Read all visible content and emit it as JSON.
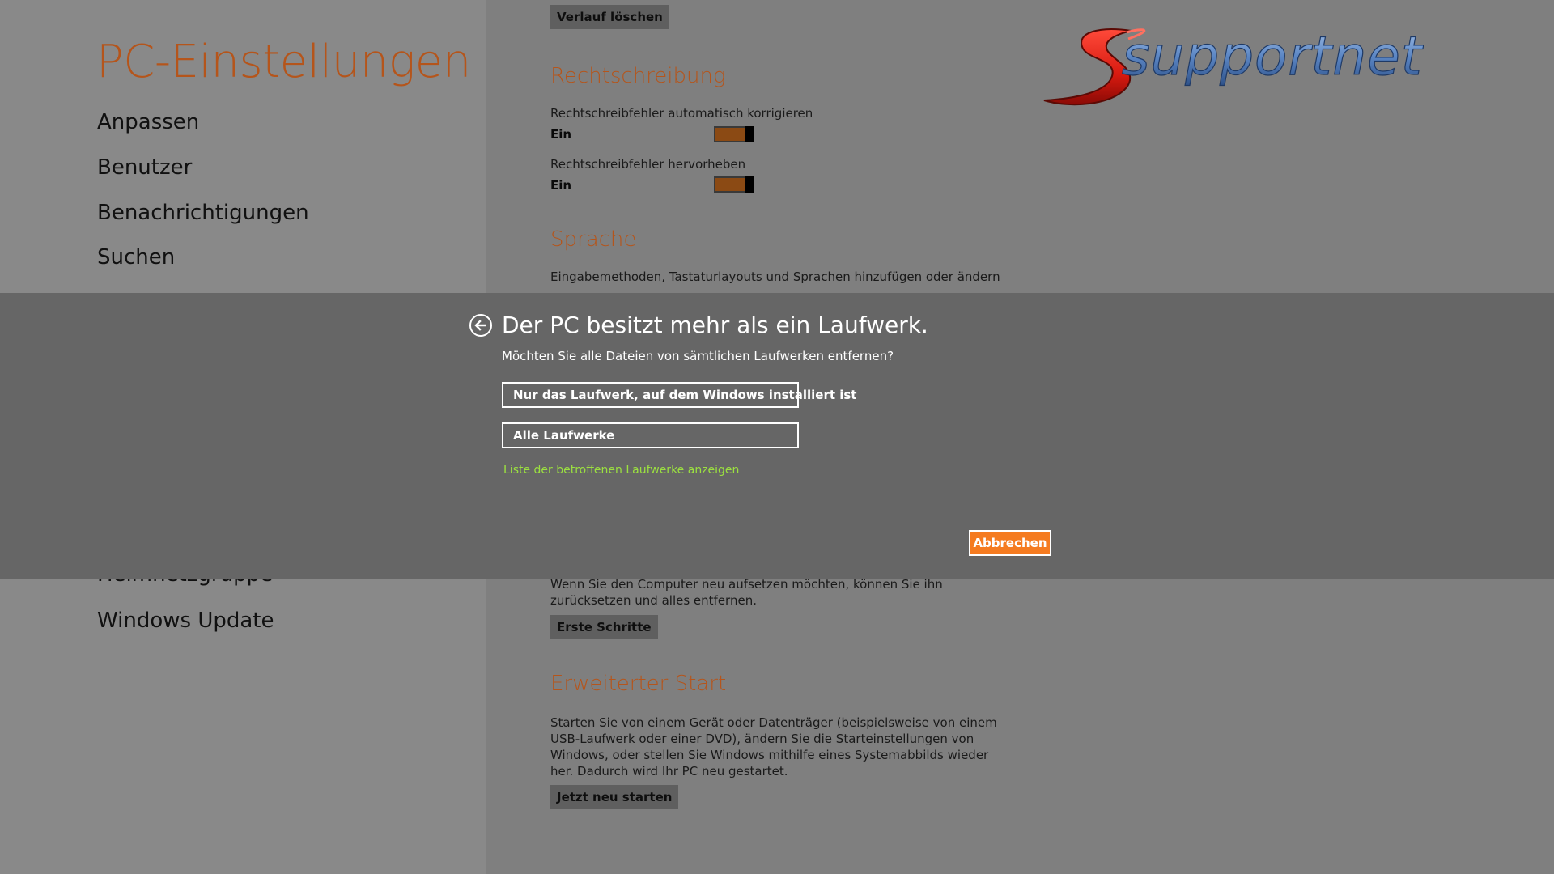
{
  "nav": {
    "title": "PC-Einstellungen",
    "items": [
      {
        "label": "Anpassen"
      },
      {
        "label": "Benutzer"
      },
      {
        "label": "Benachrichtigungen"
      },
      {
        "label": "Suchen"
      },
      {
        "label": "Heimnetzgruppe"
      },
      {
        "label": "Windows Update"
      }
    ]
  },
  "content": {
    "history_button": "Verlauf löschen",
    "spelling": {
      "title": "Rechtschreibung",
      "autocorrect_label": "Rechtschreibfehler automatisch korrigieren",
      "autocorrect_state": "Ein",
      "highlight_label": "Rechtschreibfehler hervorheben",
      "highlight_state": "Ein"
    },
    "language": {
      "title": "Sprache",
      "description": "Eingabemethoden, Tastaturlayouts und Sprachen hinzufügen oder ändern"
    },
    "reset": {
      "description": "Wenn Sie den Computer neu aufsetzen möchten, können Sie ihn zurücksetzen und alles entfernen.",
      "button": "Erste Schritte"
    },
    "advanced_start": {
      "title": "Erweiterter Start",
      "description": "Starten Sie von einem Gerät oder Datenträger (beispielsweise von einem USB-Laufwerk oder einer DVD), ändern Sie die Starteinstellungen von Windows, oder stellen Sie Windows mithilfe eines Systemabbilds wieder her. Dadurch wird Ihr PC neu gestartet.",
      "button": "Jetzt neu starten"
    }
  },
  "logo": {
    "text": "supportnet"
  },
  "dialog": {
    "title": "Der PC besitzt mehr als ein Laufwerk.",
    "subtitle": "Möchten Sie alle Dateien von sämtlichen Laufwerken entfernen?",
    "option_windows_drive": "Nur das Laufwerk, auf dem Windows installiert ist",
    "option_all_drives": "Alle Laufwerke",
    "show_list_link": "Liste der betroffenen Laufwerke anzeigen",
    "cancel": "Abbrechen"
  },
  "colors": {
    "accent": "#b5551b",
    "toggle_on": "#8b4a14",
    "cancel_button": "#f57b20",
    "link": "#9be040",
    "dialog_bg": "#666666"
  }
}
